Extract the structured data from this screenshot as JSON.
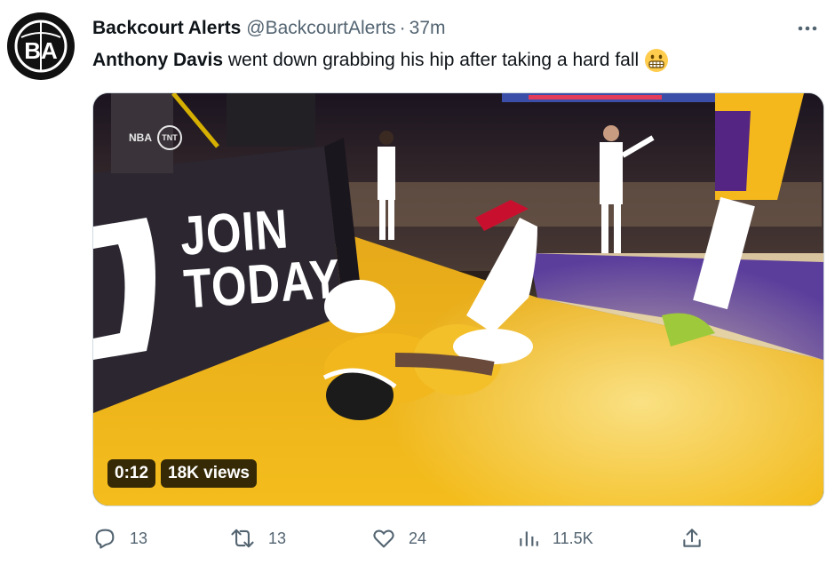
{
  "author": {
    "avatar_initials": "BA",
    "display_name": "Backcourt Alerts",
    "handle": "@BackcourtAlerts",
    "separator": "·",
    "time": "37m"
  },
  "tweet": {
    "text_bold": "Anthony Davis",
    "text_rest": "went down grabbing his hip after taking a hard fall",
    "emoji": "grimacing-face-emoji"
  },
  "media": {
    "broadcast_bug": [
      "NBA",
      "TNT"
    ],
    "pad_text": [
      "JOIN",
      "TODAY"
    ],
    "duration": "0:12",
    "views": "18K views"
  },
  "actions": {
    "replies": "13",
    "retweets": "13",
    "likes": "24",
    "views": "11.5K"
  },
  "colors": {
    "accent": "#536471",
    "lakers_gold": "#f4b81c",
    "lakers_purple": "#552583",
    "border": "#cfd9de"
  }
}
